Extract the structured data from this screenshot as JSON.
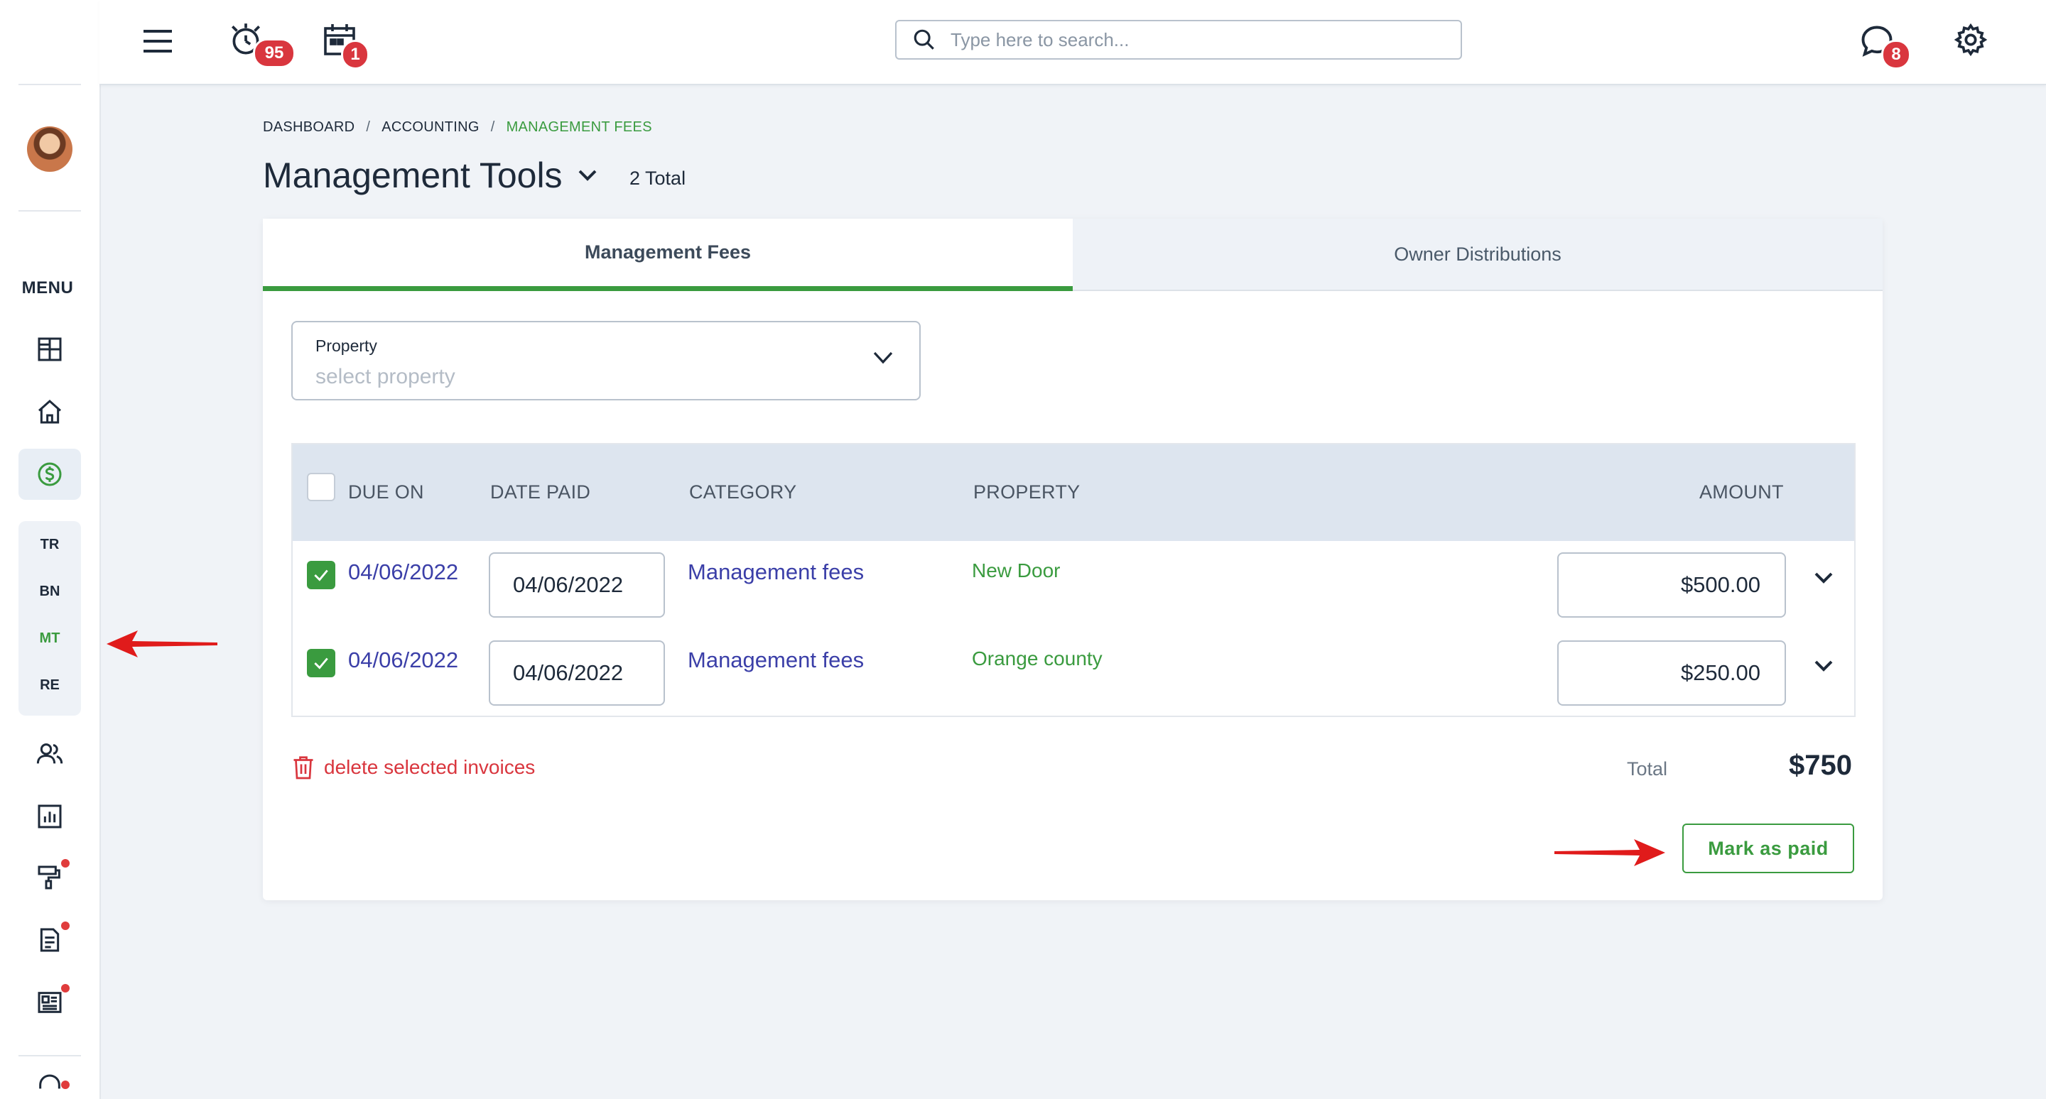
{
  "sidebar": {
    "menu_label": "MENU",
    "icons": [
      "dashboard-icon",
      "home-icon",
      "dollar-icon",
      "people-icon",
      "report-chart-icon",
      "paint-roller-icon",
      "document-icon",
      "newspaper-icon",
      "support-icon"
    ],
    "submenu": [
      {
        "label": "TR",
        "active": false
      },
      {
        "label": "BN",
        "active": false
      },
      {
        "label": "MT",
        "active": true
      },
      {
        "label": "RE",
        "active": false
      }
    ]
  },
  "topbar": {
    "alarm_badge": "95",
    "calendar_badge": "1",
    "chat_badge": "8",
    "search_placeholder": "Type here to search..."
  },
  "breadcrumb": {
    "items": [
      "DASHBOARD",
      "ACCOUNTING",
      "MANAGEMENT FEES"
    ]
  },
  "page": {
    "title": "Management Tools",
    "total_count": "2 Total"
  },
  "tabs": [
    {
      "label": "Management Fees",
      "active": true
    },
    {
      "label": "Owner Distributions",
      "active": false
    }
  ],
  "filter": {
    "label": "Property",
    "placeholder": "select property"
  },
  "table": {
    "headers": {
      "due_on": "DUE ON",
      "date_paid": "DATE PAID",
      "category": "CATEGORY",
      "property": "PROPERTY",
      "amount": "AMOUNT"
    },
    "rows": [
      {
        "checked": true,
        "due_on": "04/06/2022",
        "date_paid": "04/06/2022",
        "category": "Management fees",
        "property": "New Door",
        "amount": "$500.00"
      },
      {
        "checked": true,
        "due_on": "04/06/2022",
        "date_paid": "04/06/2022",
        "category": "Management fees",
        "property": "Orange county",
        "amount": "$250.00"
      }
    ]
  },
  "footer": {
    "delete_label": "delete selected invoices",
    "total_label": "Total",
    "total_value": "$750",
    "mark_paid_label": "Mark as paid"
  },
  "colors": {
    "accent_green": "#3a9b3f",
    "link_blue": "#3b3fa8",
    "danger_red": "#d9363e",
    "annotation_arrow": "#e01b1b"
  }
}
